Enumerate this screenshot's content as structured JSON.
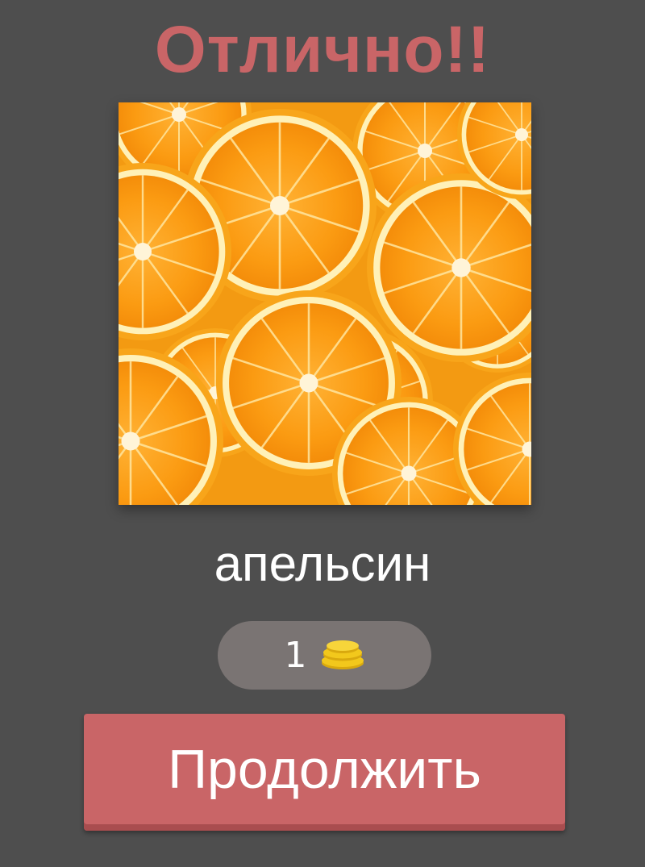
{
  "result": {
    "title": "Отлично!!",
    "answer_word": "апельсин"
  },
  "reward": {
    "count": "1",
    "icon": "coins-icon",
    "coin_color": "#f2c81c"
  },
  "actions": {
    "continue_label": "Продолжить"
  },
  "colors": {
    "background": "#4e4e4e",
    "accent": "#c96567",
    "pill": "#7a7473"
  }
}
